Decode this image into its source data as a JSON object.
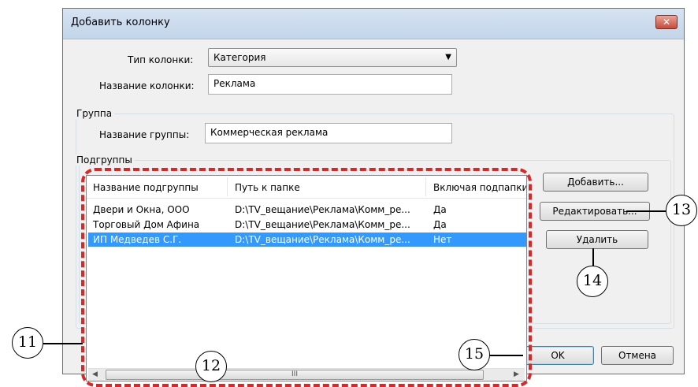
{
  "window": {
    "title": "Добавить колонку",
    "close_glyph": "✕"
  },
  "column": {
    "type_label": "Тип колонки:",
    "type_value": "Категория",
    "name_label": "Название колонки:",
    "name_value": "Реклама"
  },
  "group": {
    "title": "Группа",
    "name_label": "Название группы:",
    "name_value": "Коммерческая реклама"
  },
  "subgroups": {
    "title": "Подгруппы",
    "columns": [
      "Название подгруппы",
      "Путь к папке",
      "Включая подпапки"
    ],
    "rows": [
      {
        "name": "Двери и Окна, ООО",
        "path": "D:\\TV_вещание\\Реклама\\Комм_ре...",
        "include": "Да",
        "selected": false
      },
      {
        "name": "Торговый Дом Афина",
        "path": "D:\\TV_вещание\\Реклама\\Комм_ре...",
        "include": "Да",
        "selected": false
      },
      {
        "name": "ИП Медведев С.Г.",
        "path": "D:\\TV_вещание\\Реклама\\Комм_ре...",
        "include": "Нет",
        "selected": true
      }
    ],
    "scroll_grip": "III"
  },
  "buttons": {
    "add": "Добавить...",
    "edit": "Редактировать...",
    "delete": "Удалить",
    "ok": "OK",
    "cancel": "Отмена"
  },
  "callouts": {
    "c11": "11",
    "c12": "12",
    "c13": "13",
    "c14": "14",
    "c15": "15"
  },
  "colors": {
    "selection": "#3399ff",
    "highlight_dash": "#d42a2a"
  }
}
